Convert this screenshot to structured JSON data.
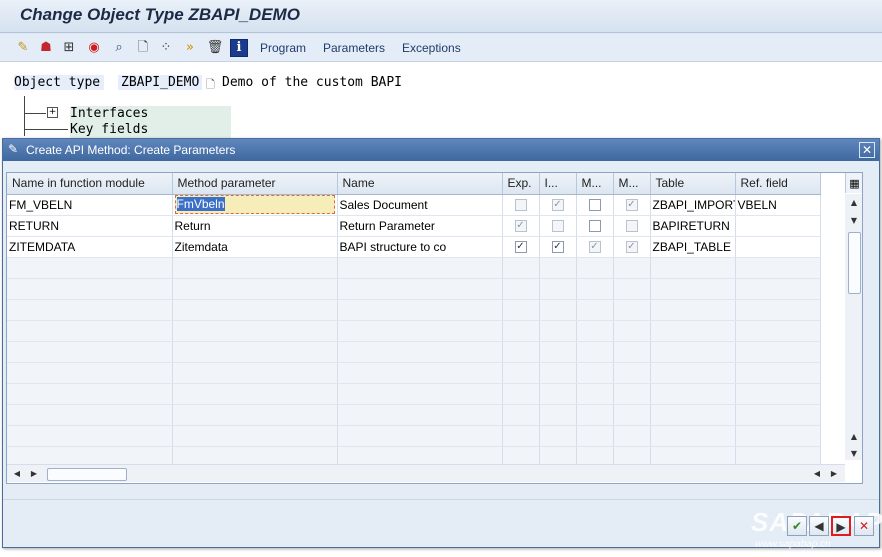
{
  "window": {
    "title": "Change Object Type ZBAPI_DEMO"
  },
  "toolbar": {
    "icons": [
      "wand-icon",
      "hat-icon",
      "hierarchy-icon",
      "lifebuoy-icon",
      "search-icon",
      "document-icon",
      "structure-icon",
      "forward-icon",
      "trash-icon",
      "info-icon"
    ],
    "menus": [
      "Program",
      "Parameters",
      "Exceptions"
    ]
  },
  "object": {
    "label": "Object type",
    "value": "ZBAPI_DEMO",
    "description": "Demo of the custom BAPI"
  },
  "tree": {
    "items": [
      "Interfaces",
      "Key fields"
    ]
  },
  "dialog": {
    "title": "Create API Method: Create Parameters",
    "columns": [
      "Name in function module",
      "Method parameter",
      "Name",
      "Exp.",
      "I...",
      "M...",
      "M...",
      "Table",
      "Ref. field"
    ],
    "rows": [
      {
        "fm_name": "FM_VBELN",
        "method_param": "FmVbeln",
        "name": "Sales Document",
        "checks": [
          false,
          true,
          false,
          true
        ],
        "checks_enabled": [
          false,
          false,
          true,
          false
        ],
        "table": "ZBAPI_IMPORT",
        "ref_field": "VBELN"
      },
      {
        "fm_name": "RETURN",
        "method_param": "Return",
        "name": "Return Parameter",
        "checks": [
          true,
          false,
          false,
          false
        ],
        "checks_enabled": [
          false,
          false,
          true,
          false
        ],
        "table": "BAPIRETURN",
        "ref_field": ""
      },
      {
        "fm_name": "ZITEMDATA",
        "method_param": "Zitemdata",
        "name": "BAPI structure to co",
        "checks": [
          true,
          true,
          true,
          true
        ],
        "checks_enabled": [
          true,
          true,
          false,
          false
        ],
        "table": "ZBAPI_TABLE",
        "ref_field": ""
      }
    ],
    "buttons": [
      "accept-icon",
      "back-icon",
      "next-icon",
      "cancel-icon"
    ]
  },
  "watermark": {
    "brand": "SAPABAP",
    "url": "www.sapabap.cn"
  },
  "colors": {
    "title_bar": "#3f689f",
    "edit_cell": "#f7edb8",
    "selection": "#3a70c7",
    "highlight": "#e01b1b"
  }
}
